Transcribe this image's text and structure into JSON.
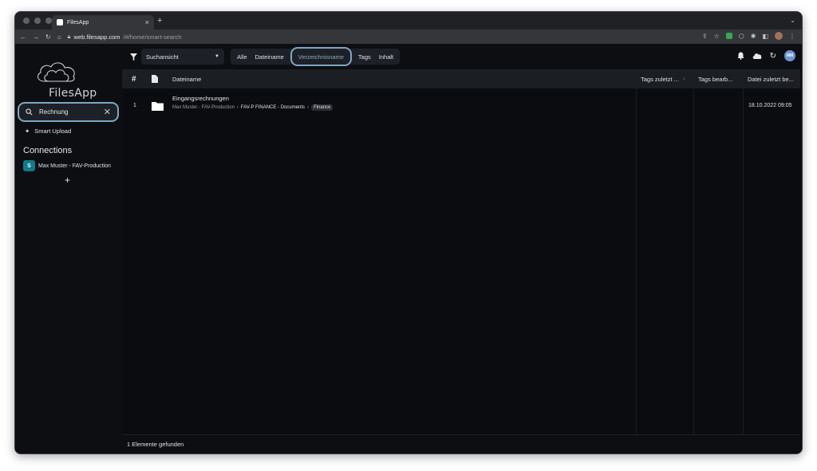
{
  "browser": {
    "tab_title": "FilesApp",
    "url_host": "web.filesapp.com",
    "url_path": "/#/home/smart-search"
  },
  "sidebar": {
    "logo_text": "FilesApp",
    "search": {
      "value": "Rechnung",
      "placeholder": ""
    },
    "smart_upload_label": "Smart Upload",
    "connections_title": "Connections",
    "connections": [
      {
        "label": "Max Muster - FAV-Production"
      }
    ],
    "add_label": "+"
  },
  "toolbar": {
    "view_select": "Suchansicht",
    "filters": [
      "Alle",
      "Dateiname",
      "Verzeichnisname",
      "Tags",
      "Inhalt"
    ],
    "active_filter": "Verzeichnisname",
    "avatar_initials": "MM"
  },
  "table": {
    "columns": {
      "num": "#",
      "filename": "Dateiname",
      "tags_changed": "Tags zuletzt ...",
      "tags_editor": "Tags bearb...",
      "file_changed": "Datei zuletzt be..."
    },
    "rows": [
      {
        "index": "1",
        "name": "Eingangsrechnungen",
        "path_1": "Max Muster - FAV-Production",
        "path_2": "FAV-P FINANCE - Documents",
        "path_3": "Finance",
        "date": "18.10.2022 09:05"
      }
    ]
  },
  "footer": {
    "count_text": "1 Elemente gefunden"
  },
  "colors": {
    "accent": "#7ea6c4",
    "background": "#0c0e12",
    "header": "#1b1e23"
  }
}
